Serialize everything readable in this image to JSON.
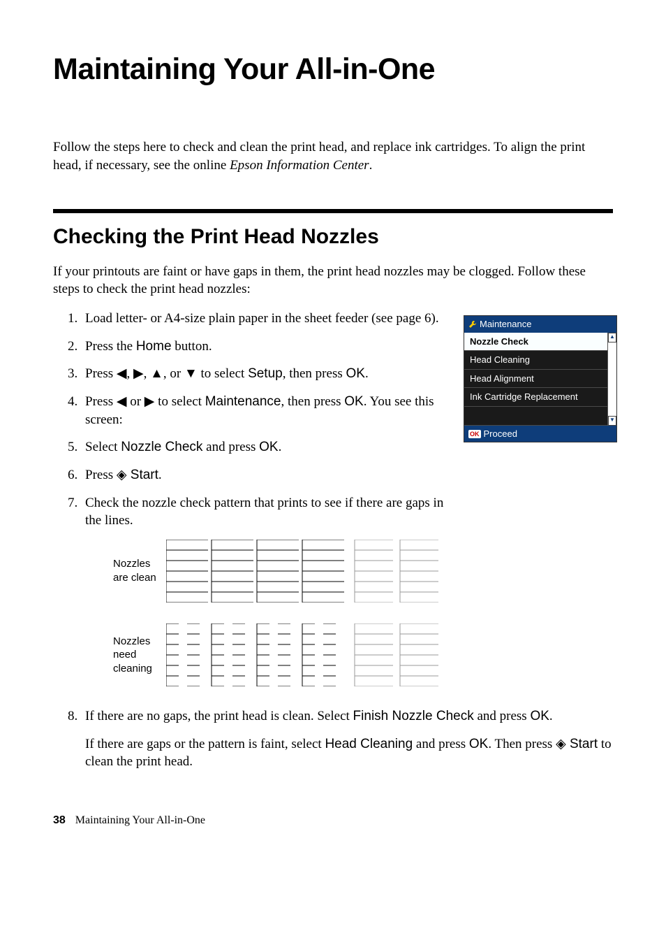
{
  "title": "Maintaining Your All-in-One",
  "intro_part1": "Follow the steps here to check and clean the print head, and replace ink cartridges. To align the print head, if necessary, see the online ",
  "intro_italic": "Epson Information Center",
  "intro_part2": ".",
  "section_heading": "Checking the Print Head Nozzles",
  "section_intro": "If your printouts are faint or have gaps in them, the print head nozzles may be clogged. Follow these steps to check the print head nozzles:",
  "steps": {
    "s1": "Load letter- or A4-size plain paper in the sheet feeder (see page 6).",
    "s2_a": "Press the ",
    "s2_home": "Home",
    "s2_b": " button.",
    "s3_a": "Press ◀, ▶, ▲, or ▼ to select ",
    "s3_setup": "Setup",
    "s3_b": ", then press ",
    "s3_ok": "OK",
    "s3_c": ".",
    "s4_a": "Press ◀ or ▶ to select ",
    "s4_maint": "Maintenance",
    "s4_b": ", then press ",
    "s4_ok": "OK",
    "s4_c": ". You see this screen:",
    "s5_a": "Select ",
    "s5_nozzle": "Nozzle Check",
    "s5_b": " and press ",
    "s5_ok": "OK",
    "s5_c": ".",
    "s6_a": "Press ",
    "s6_diamond": "◈",
    "s6_start": " Start",
    "s6_b": ".",
    "s7": "Check the nozzle check pattern that prints to see if there are gaps in the lines.",
    "s8_a": "If there are no gaps, the print head is clean. Select ",
    "s8_finish": "Finish Nozzle Check",
    "s8_b": " and press ",
    "s8_ok1": "OK",
    "s8_c": ".",
    "s8_p2_a": "If there are gaps or the pattern is faint, select ",
    "s8_headclean": "Head Cleaning",
    "s8_p2_b": " and press ",
    "s8_ok2": "OK",
    "s8_p2_c": ". Then press ",
    "s8_diamond": "◈",
    "s8_start": " Start",
    "s8_p2_d": " to clean the print head."
  },
  "screen": {
    "header": "Maintenance",
    "items": [
      "Nozzle Check",
      "Head Cleaning",
      "Head Alignment",
      "Ink Cartridge Replacement"
    ],
    "footer_ok": "OK",
    "footer": "Proceed"
  },
  "nozzle": {
    "clean_label": "Nozzles are clean",
    "dirty_label": "Nozzles need cleaning"
  },
  "footer": {
    "page": "38",
    "chapter": "Maintaining Your All-in-One"
  }
}
